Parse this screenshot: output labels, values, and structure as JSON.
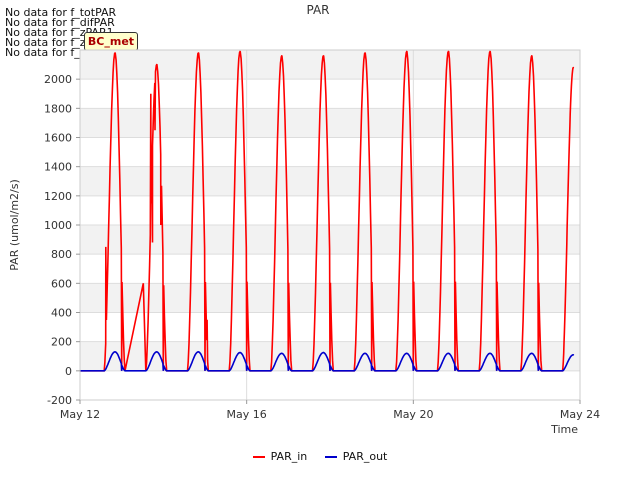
{
  "notes": [
    "No data for f_totPAR",
    "No data for f_difPAR",
    "No data for f_zPAR1",
    "No data for f_zPAR2",
    "No data for f_zPAR3"
  ],
  "badge": "BC_met",
  "chart_data": {
    "type": "line",
    "title": "PAR",
    "xlabel": "Time",
    "ylabel": "PAR (umol/m2/s)",
    "xlim": [
      "2024-05-12",
      "2024-05-24"
    ],
    "ylim": [
      -200,
      2200
    ],
    "x_ticks": [
      "May 12",
      "May 16",
      "May 20",
      "May 24"
    ],
    "y_ticks": [
      -200,
      0,
      200,
      400,
      600,
      800,
      1000,
      1200,
      1400,
      1600,
      1800,
      2000
    ],
    "grid": true,
    "legend_position": "bottom",
    "series": [
      {
        "name": "PAR_in",
        "color": "#ff0000",
        "daily_peaks": [
          {
            "date": "2024-05-12",
            "peak_x": 0.84,
            "peak": 2180,
            "sunrise": 0.58,
            "sunset": 1.08
          },
          {
            "date": "2024-05-13",
            "peak_x": 1.84,
            "peak": 2100,
            "sunrise": 1.58,
            "sunset": 2.08
          },
          {
            "date": "2024-05-14",
            "peak_x": 2.84,
            "peak": 2180,
            "sunrise": 2.58,
            "sunset": 3.08
          },
          {
            "date": "2024-05-15",
            "peak_x": 3.84,
            "peak": 2190,
            "sunrise": 3.58,
            "sunset": 4.08
          },
          {
            "date": "2024-05-16",
            "peak_x": 4.84,
            "peak": 2160,
            "sunrise": 4.58,
            "sunset": 5.08
          },
          {
            "date": "2024-05-17",
            "peak_x": 5.84,
            "peak": 2160,
            "sunrise": 5.58,
            "sunset": 6.08
          },
          {
            "date": "2024-05-18",
            "peak_x": 6.84,
            "peak": 2180,
            "sunrise": 6.58,
            "sunset": 7.08
          },
          {
            "date": "2024-05-19",
            "peak_x": 7.84,
            "peak": 2190,
            "sunrise": 7.58,
            "sunset": 8.08
          },
          {
            "date": "2024-05-20",
            "peak_x": 8.84,
            "peak": 2190,
            "sunrise": 8.58,
            "sunset": 9.08
          },
          {
            "date": "2024-05-21",
            "peak_x": 9.84,
            "peak": 2190,
            "sunrise": 9.58,
            "sunset": 10.08
          },
          {
            "date": "2024-05-22",
            "peak_x": 10.84,
            "peak": 2160,
            "sunrise": 10.58,
            "sunset": 11.08
          },
          {
            "date": "2024-05-23",
            "peak_x": 11.84,
            "peak": 2080,
            "sunrise": 11.58,
            "sunset": 11.84
          }
        ]
      },
      {
        "name": "PAR_out",
        "color": "#0000cc",
        "daily_peaks": [
          {
            "date": "2024-05-12",
            "peak": 130
          },
          {
            "date": "2024-05-13",
            "peak": 130
          },
          {
            "date": "2024-05-14",
            "peak": 130
          },
          {
            "date": "2024-05-15",
            "peak": 125
          },
          {
            "date": "2024-05-16",
            "peak": 120
          },
          {
            "date": "2024-05-17",
            "peak": 125
          },
          {
            "date": "2024-05-18",
            "peak": 120
          },
          {
            "date": "2024-05-19",
            "peak": 120
          },
          {
            "date": "2024-05-20",
            "peak": 120
          },
          {
            "date": "2024-05-21",
            "peak": 120
          },
          {
            "date": "2024-05-22",
            "peak": 120
          },
          {
            "date": "2024-05-23",
            "peak": 110
          }
        ]
      }
    ],
    "irregular_readings": [
      {
        "series": "PAR_in",
        "x": 0.62,
        "y": 850
      },
      {
        "series": "PAR_in",
        "x": 1.52,
        "y": 600
      },
      {
        "series": "PAR_in",
        "x": 1.7,
        "y": 1900
      },
      {
        "series": "PAR_in",
        "x": 1.74,
        "y": 880
      },
      {
        "series": "PAR_in",
        "x": 1.8,
        "y": 1650
      },
      {
        "series": "PAR_in",
        "x": 1.94,
        "y": 1000
      },
      {
        "series": "PAR_in",
        "x": 3.05,
        "y": 350
      },
      {
        "series": "PAR_in",
        "x": 6.0,
        "y": 600
      }
    ]
  }
}
